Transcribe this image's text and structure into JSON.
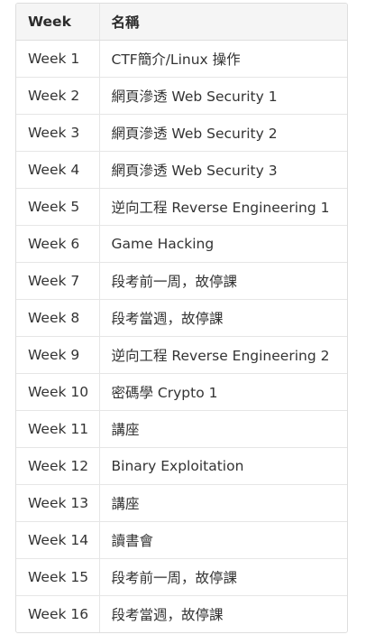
{
  "table": {
    "headers": [
      "Week",
      "名稱"
    ],
    "rows": [
      [
        "Week 1",
        "CTF簡介/Linux 操作"
      ],
      [
        "Week 2",
        "網頁滲透 Web Security 1"
      ],
      [
        "Week 3",
        "網頁滲透 Web Security 2"
      ],
      [
        "Week 4",
        "網頁滲透 Web Security 3"
      ],
      [
        "Week 5",
        "逆向工程 Reverse Engineering 1"
      ],
      [
        "Week 6",
        "Game Hacking"
      ],
      [
        "Week 7",
        "段考前一周，故停課"
      ],
      [
        "Week 8",
        "段考當週，故停課"
      ],
      [
        "Week 9",
        "逆向工程 Reverse Engineering 2"
      ],
      [
        "Week 10",
        "密碼學 Crypto 1"
      ],
      [
        "Week 11",
        "講座"
      ],
      [
        "Week 12",
        "Binary Exploitation"
      ],
      [
        "Week 13",
        "講座"
      ],
      [
        "Week 14",
        "讀書會"
      ],
      [
        "Week 15",
        "段考前一周，故停課"
      ],
      [
        "Week 16",
        "段考當週，故停課"
      ]
    ]
  }
}
